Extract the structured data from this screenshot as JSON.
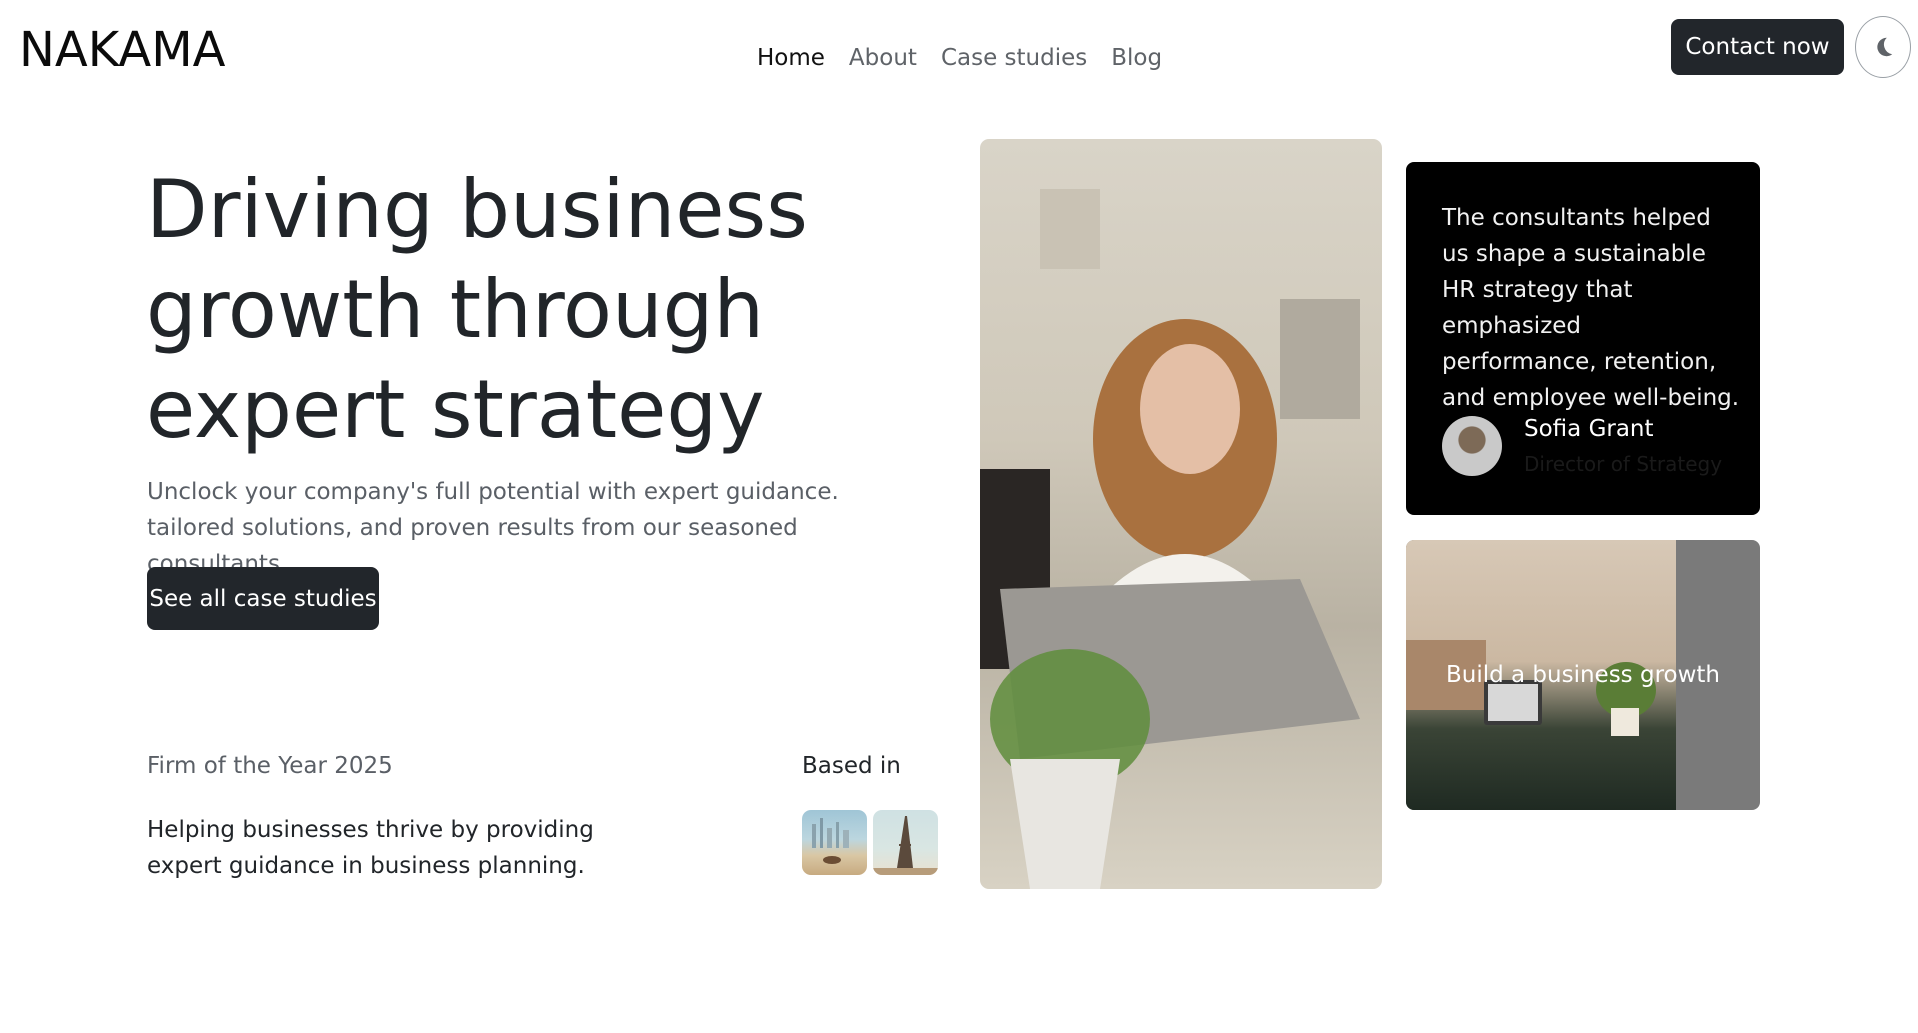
{
  "header": {
    "logo": "NAKAMA",
    "nav": [
      {
        "label": "Home",
        "active": true
      },
      {
        "label": "About",
        "active": false
      },
      {
        "label": "Case studies",
        "active": false
      },
      {
        "label": "Blog",
        "active": false
      }
    ],
    "contact_label": "Contact now",
    "theme_toggle_icon": "moon-icon"
  },
  "hero": {
    "title": "Driving business growth through expert strategy",
    "subtitle": "Unclock your company's full potential with expert guidance. tailored solutions, and proven results from our seasoned consultants.",
    "cta_label": "See all case studies"
  },
  "info": {
    "award": "Firm of the Year 2025",
    "award_desc": "Helping businesses thrive by providing expert guidance in business planning.",
    "based_label": "Based in"
  },
  "testimonial": {
    "quote": "The consultants helped us shape a sustainable HR strategy that emphasized performance, retention, and employee well-being.",
    "name": "Sofia Grant",
    "role": "Director of Strategy"
  },
  "growth_card": {
    "label": "Build a business growth"
  },
  "colors": {
    "dark_button": "#22262b",
    "testimonial_bg": "#000000",
    "muted_text": "#5a5f66"
  }
}
